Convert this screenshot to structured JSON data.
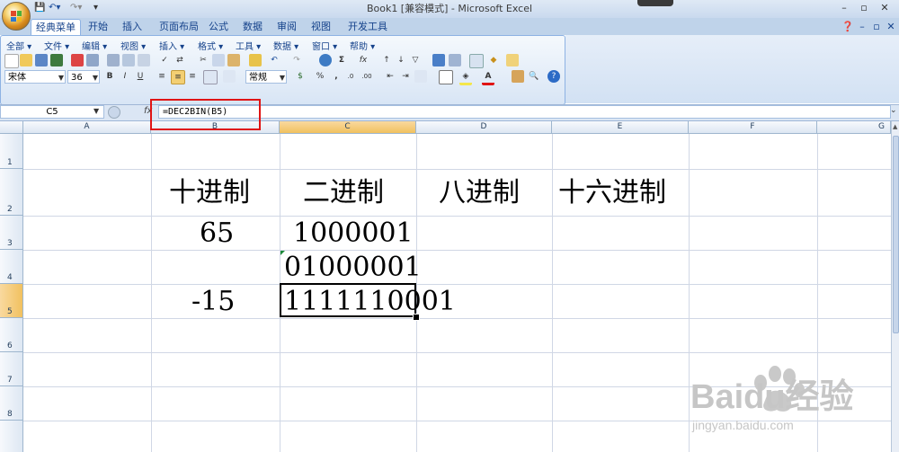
{
  "window": {
    "title": "Book1  [兼容模式] - Microsoft Excel",
    "controls": [
      "–",
      "▫",
      "✕"
    ],
    "ribbon_controls": [
      "–",
      "▫",
      "✕"
    ]
  },
  "tabs": [
    "经典菜单",
    "开始",
    "插入",
    "页面布局",
    "公式",
    "数据",
    "审阅",
    "视图",
    "开发工具"
  ],
  "classic_menu": [
    "全部 ▾",
    "文件 ▾",
    "编辑 ▾",
    "视图 ▾",
    "插入 ▾",
    "格式 ▾",
    "工具 ▾",
    "数据 ▾",
    "窗口 ▾",
    "帮助 ▾"
  ],
  "toolbar": {
    "font_name": "宋体",
    "font_size": "36",
    "bold": "B",
    "italic": "I",
    "underline": "U",
    "number_format": "常规",
    "percent": "%",
    "comma": ","
  },
  "formula_bar": {
    "name_box": "C5",
    "fx": "fx",
    "formula": "=DEC2BIN(B5)"
  },
  "columns": [
    "A",
    "B",
    "C",
    "D",
    "E",
    "F",
    "G"
  ],
  "rows": [
    "1",
    "2",
    "3",
    "4",
    "5",
    "6",
    "7",
    "8"
  ],
  "cells": {
    "B2": "十进制",
    "C2": "二进制",
    "D2": "八进制",
    "E2": "十六进制",
    "B3": "65",
    "C3": "1000001",
    "C4": "01000001",
    "B5": "-15",
    "C5": "1111110001"
  },
  "colors": {
    "selection_header": "#f1c15f",
    "highlight_box": "#e01414",
    "ribbon_bg": "#dbe6f4"
  },
  "watermark": {
    "brand": "Baidu经验",
    "url": "jingyan.baidu.com"
  }
}
